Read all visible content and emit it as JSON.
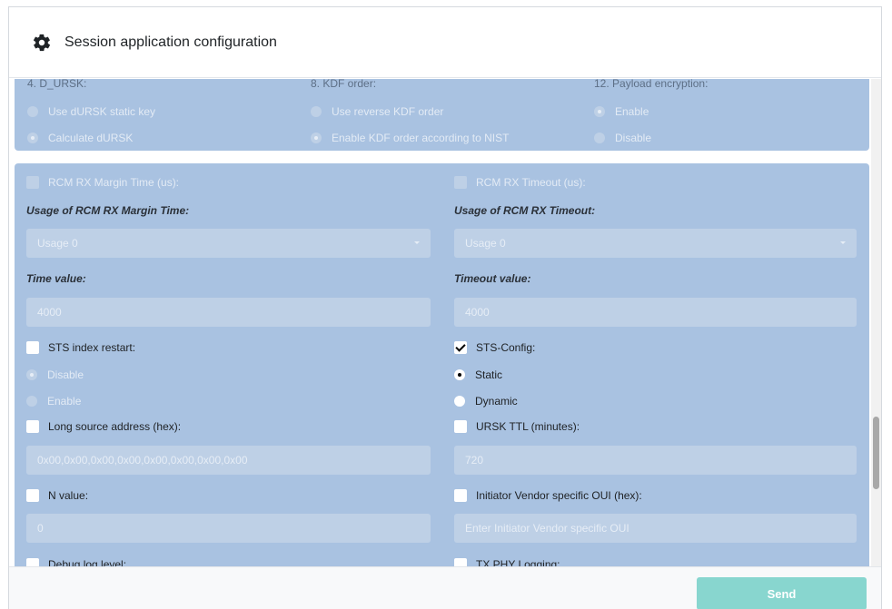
{
  "header": {
    "title": "Session application configuration",
    "icon": "gear-icon"
  },
  "top_panel": {
    "col1": {
      "label": "4. D_URSK:",
      "options": [
        "Use dURSK static key",
        "Calculate dURSK"
      ],
      "selected": 1
    },
    "col2": {
      "label": "8. KDF order:",
      "options": [
        "Use reverse KDF order",
        "Enable KDF order according to NIST"
      ],
      "selected": 1
    },
    "col3": {
      "label": "12. Payload encryption:",
      "options": [
        "Enable",
        "Disable"
      ],
      "selected": 0
    }
  },
  "main_panel": {
    "left": {
      "rcm_margin_check": "RCM RX Margin Time (us):",
      "usage_label": "Usage of RCM RX Margin Time:",
      "usage_value": "Usage 0",
      "time_label": "Time value:",
      "time_value": "4000",
      "sts_restart": "STS index restart:",
      "sts_restart_options": [
        "Disable",
        "Enable"
      ],
      "long_addr": "Long source address (hex):",
      "long_addr_value": "0x00,0x00,0x00,0x00,0x00,0x00,0x00,0x00",
      "n_value": "N value:",
      "n_value_value": "0",
      "debug_log": "Debug log level:"
    },
    "right": {
      "rcm_timeout_check": "RCM RX Timeout (us):",
      "usage_label": "Usage of RCM RX Timeout:",
      "usage_value": "Usage 0",
      "timeout_label": "Timeout value:",
      "timeout_value": "4000",
      "sts_config": "STS-Config:",
      "sts_config_options": [
        "Static",
        "Dynamic"
      ],
      "ursk_ttl": "URSK TTL (minutes):",
      "ursk_ttl_value": "720",
      "initiator_oui": "Initiator Vendor specific OUI (hex):",
      "initiator_oui_placeholder": "Enter Initiator Vendor specific OUI",
      "tx_phy": "TX PHY Logging:"
    }
  },
  "footer": {
    "send_label": "Send"
  }
}
